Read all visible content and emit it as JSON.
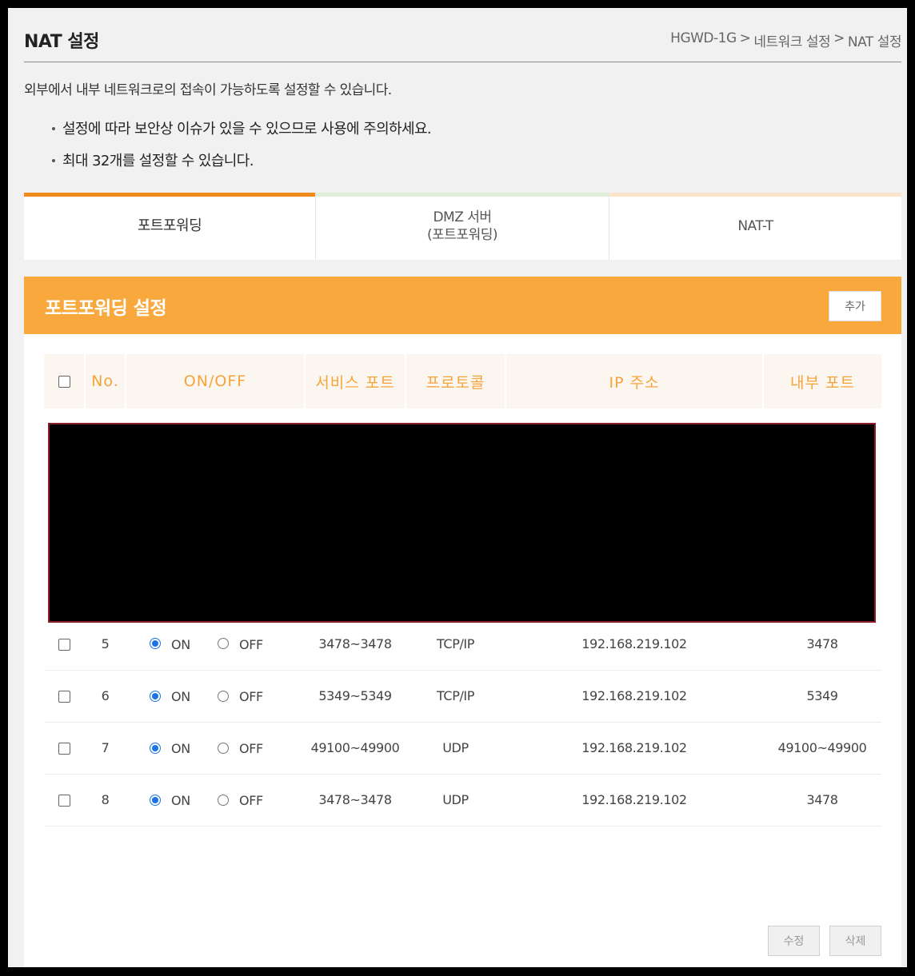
{
  "header": {
    "title": "NAT 설정",
    "breadcrumb": [
      "HGWD-1G",
      "네트워크 설정",
      "NAT 설정"
    ],
    "breadcrumb_sep": ">"
  },
  "description": "외부에서 내부 네트워크로의 접속이 가능하도록 설정할 수 있습니다.",
  "notes": [
    "설정에 따라 보안상 이슈가 있을 수 있으므로 사용에 주의하세요.",
    "최대 32개를 설정할 수 있습니다."
  ],
  "tabs": [
    {
      "label": "포트포워딩",
      "label2": "",
      "bar_color": "#f08a1c"
    },
    {
      "label": "DMZ 서버",
      "label2": "(포트포워딩)",
      "bar_color": "#dfefdc"
    },
    {
      "label": "NAT-T",
      "label2": "",
      "bar_color": "#fde3cb"
    }
  ],
  "panel": {
    "title": "포트포워딩 설정",
    "add_label": "추가",
    "edit_label": "수정",
    "delete_label": "삭제"
  },
  "table": {
    "headers": [
      "No.",
      "ON/OFF",
      "서비스 포트",
      "프로토콜",
      "IP 주소",
      "내부 포트"
    ],
    "on_label": "ON",
    "off_label": "OFF",
    "rows": [
      {
        "no": "5",
        "on": true,
        "service_port": "3478~3478",
        "protocol": "TCP/IP",
        "ip": "192.168.219.102",
        "internal_port": "3478"
      },
      {
        "no": "6",
        "on": true,
        "service_port": "5349~5349",
        "protocol": "TCP/IP",
        "ip": "192.168.219.102",
        "internal_port": "5349"
      },
      {
        "no": "7",
        "on": true,
        "service_port": "49100~49900",
        "protocol": "UDP",
        "ip": "192.168.219.102",
        "internal_port": "49100~49900"
      },
      {
        "no": "8",
        "on": true,
        "service_port": "3478~3478",
        "protocol": "UDP",
        "ip": "192.168.219.102",
        "internal_port": "3478"
      }
    ]
  },
  "colors": {
    "accent": "#f9a83e",
    "header_text": "#f5a43c",
    "radio_checked": "#1a73e8"
  }
}
